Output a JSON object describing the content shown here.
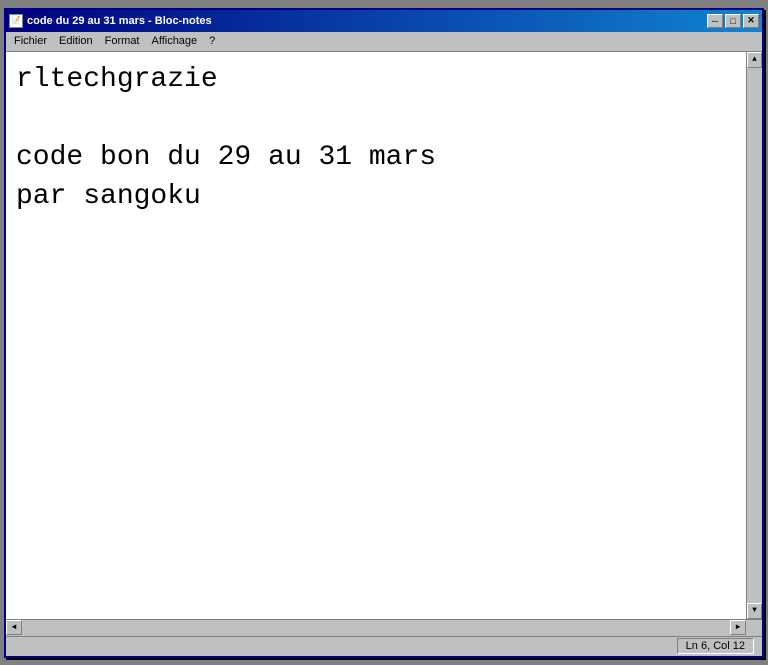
{
  "window": {
    "title": "code du 29 au 31 mars - Bloc-notes",
    "icon": "📝"
  },
  "titlebar": {
    "minimize_label": "─",
    "maximize_label": "□",
    "close_label": "✕"
  },
  "menubar": {
    "items": [
      {
        "label": "Fichier"
      },
      {
        "label": "Edition"
      },
      {
        "label": "Format"
      },
      {
        "label": "Affichage"
      },
      {
        "label": "?"
      }
    ]
  },
  "editor": {
    "content": "rltechgrazie\n\ncode bon du 29 au 31 mars\npar sangoku"
  },
  "status": {
    "position": "Ln 6, Col 12"
  },
  "scrollbar": {
    "up_arrow": "▲",
    "down_arrow": "▼",
    "left_arrow": "◄",
    "right_arrow": "►"
  }
}
